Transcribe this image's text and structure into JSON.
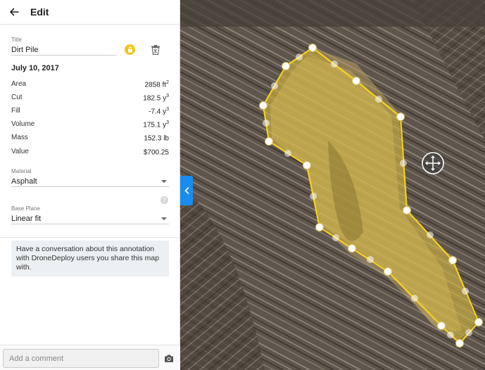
{
  "header": {
    "title": "Edit"
  },
  "annotation": {
    "title_label": "Title",
    "title_value": "Dirt Pile",
    "date": "July 10, 2017"
  },
  "measurements": [
    {
      "label": "Area",
      "value": "2858 ft",
      "sup": "2"
    },
    {
      "label": "Cut",
      "value": "182.5 y",
      "sup": "3"
    },
    {
      "label": "Fill",
      "value": "-7.4 y",
      "sup": "3"
    },
    {
      "label": "Volume",
      "value": "175.1 y",
      "sup": "3"
    },
    {
      "label": "Mass",
      "value": "152.3 lb",
      "sup": ""
    },
    {
      "label": "Value",
      "value": "$700.25",
      "sup": ""
    }
  ],
  "material": {
    "label": "Material",
    "value": "Asphalt"
  },
  "base_plane": {
    "label": "Base Plane",
    "value": "Linear fit"
  },
  "help_icon_glyph": "?",
  "info": {
    "text": "Have a conversation about this annotation with DroneDeploy users you share this map with."
  },
  "comment": {
    "placeholder": "Add a comment"
  },
  "colors": {
    "accent": "#1a8cf0",
    "polygon": "#f5d21e",
    "lock": "#f2c418"
  }
}
